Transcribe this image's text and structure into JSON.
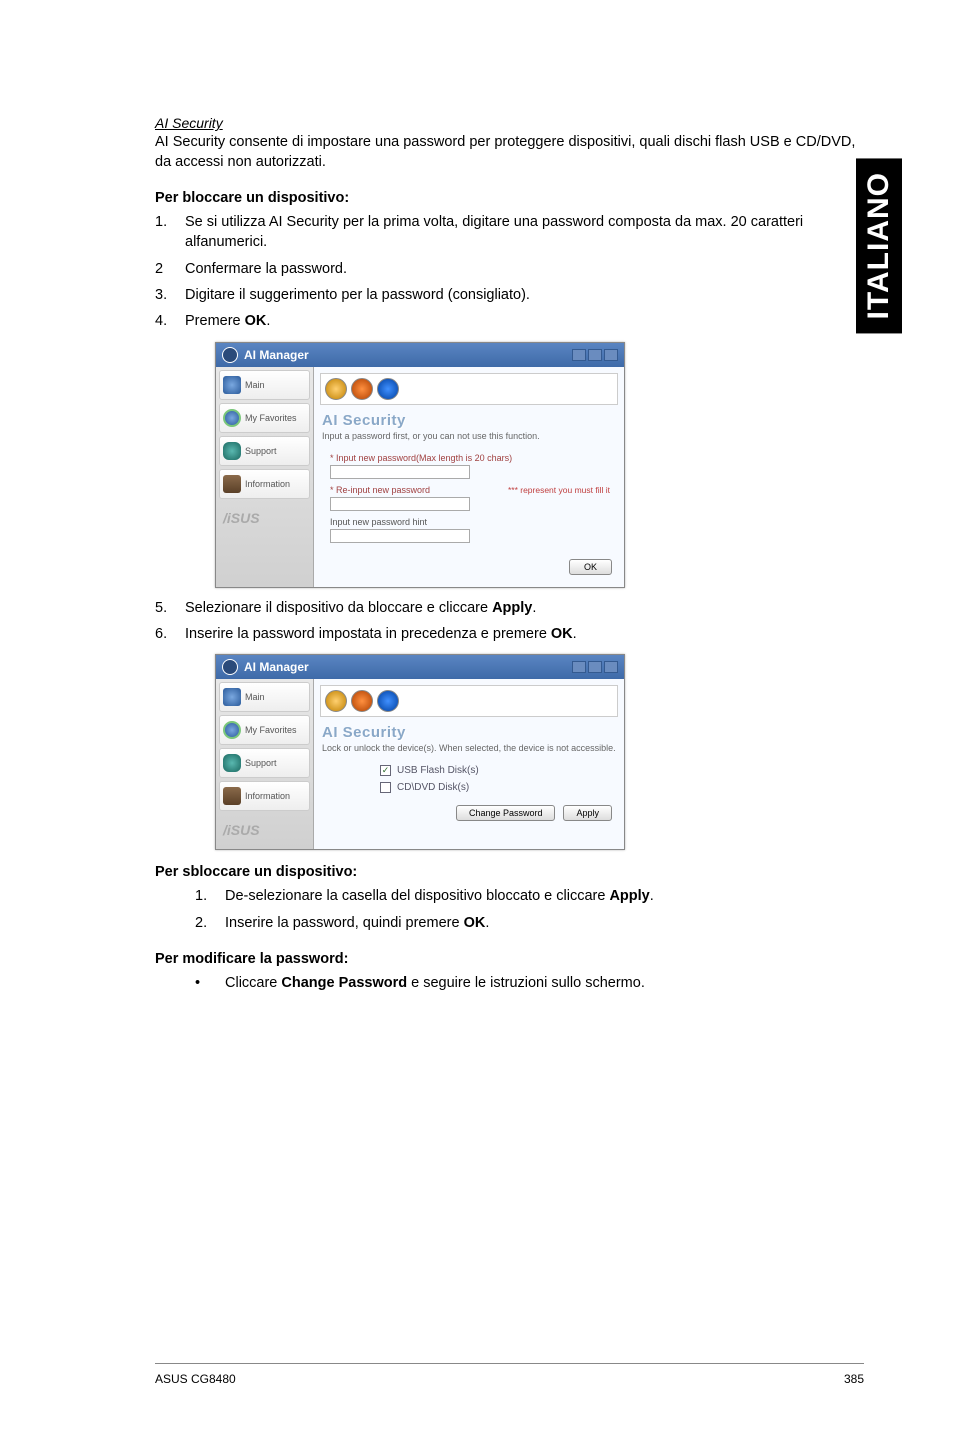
{
  "side_tab": "ITALIANO",
  "sec_title": "AI Security",
  "intro": "AI Security consente di impostare una password per proteggere dispositivi, quali dischi flash USB e CD/DVD, da accessi non autorizzati.",
  "lock_heading": "Per bloccare un dispositivo:",
  "lock_steps": [
    {
      "n": "1.",
      "t_pre": "Se si utilizza AI Security per la prima volta, digitare una password composta da max. 20 caratteri alfanumerici."
    },
    {
      "n": "2",
      "t_pre": "Confermare la password."
    },
    {
      "n": "3.",
      "t_pre": "Digitare il suggerimento per la password (consigliato)."
    },
    {
      "n": "4.",
      "t_pre": "Premere ",
      "bold": "OK",
      "post": "."
    }
  ],
  "lock_steps2": [
    {
      "n": "5.",
      "t_pre": "Selezionare il dispositivo da bloccare e cliccare ",
      "bold": "Apply",
      "post": "."
    },
    {
      "n": "6.",
      "t_pre": "Inserire la password impostata in precedenza e premere ",
      "bold": "OK",
      "post": "."
    }
  ],
  "unlock_heading": "Per sbloccare un dispositivo:",
  "unlock_steps": [
    {
      "n": "1.",
      "t_pre": "De-selezionare la casella del dispositivo bloccato e cliccare ",
      "bold": "Apply",
      "post": "."
    },
    {
      "n": "2.",
      "t_pre": "Inserire la password, quindi premere ",
      "bold": "OK",
      "post": "."
    }
  ],
  "change_heading": "Per modificare la password:",
  "change_bullet_pre": "Cliccare ",
  "change_bullet_bold": "Change Password",
  "change_bullet_post": " e seguire le istruzioni sullo schermo.",
  "app1": {
    "title": "AI Manager",
    "side": {
      "main": "Main",
      "fav": "My Favorites",
      "support": "Support",
      "info": "Information"
    },
    "brand": "/iSUS",
    "pane_title": "AI Security",
    "pane_sub": "Input a password first, or you can not use this function.",
    "hint1": "* Input new password(Max length is 20 chars)",
    "hint2": "* Re-input new password",
    "warn": "*** represent you must fill it",
    "hint3": "Input new password hint",
    "ok": "OK"
  },
  "app2": {
    "title": "AI Manager",
    "side": {
      "main": "Main",
      "fav": "My Favorites",
      "support": "Support",
      "info": "Information"
    },
    "brand": "/iSUS",
    "pane_title": "AI Security",
    "pane_sub": "Lock or unlock the device(s). When selected, the device is not accessible.",
    "chk1": "USB Flash Disk(s)",
    "chk2": "CD\\DVD Disk(s)",
    "btn_change": "Change Password",
    "btn_apply": "Apply"
  },
  "footer": {
    "left": "ASUS CG8480",
    "right": "385"
  }
}
